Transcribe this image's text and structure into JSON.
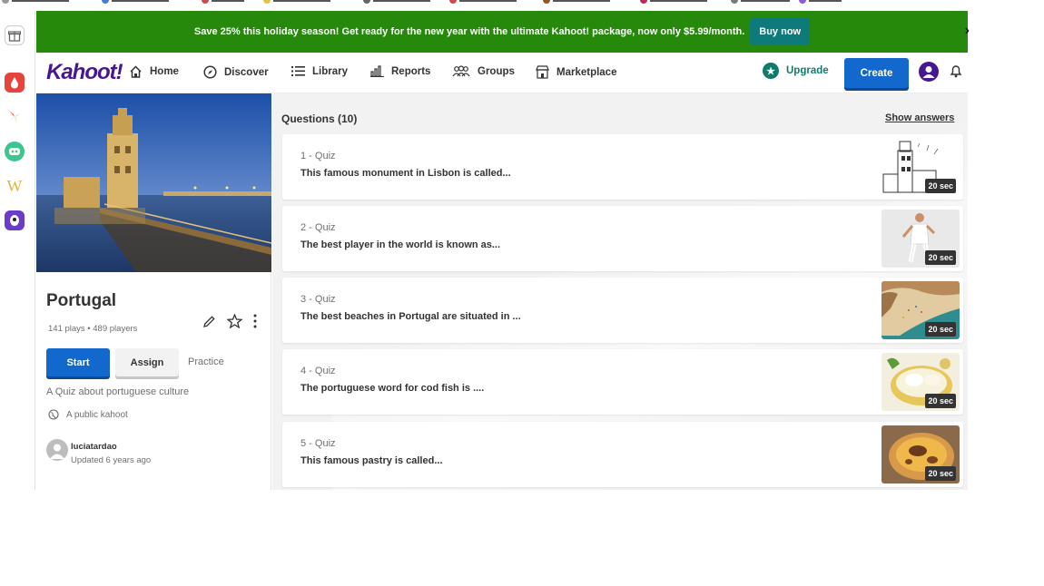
{
  "banner": {
    "message": "Save 25% this holiday season! Get ready for the new year with the ultimate Kahoot! package, now only $5.99/month.",
    "buy_label": "Buy now"
  },
  "header": {
    "logo": "Kahoot!",
    "nav": [
      {
        "label": "Home",
        "icon": "home-icon"
      },
      {
        "label": "Discover",
        "icon": "compass-icon"
      },
      {
        "label": "Library",
        "icon": "list-icon"
      },
      {
        "label": "Reports",
        "icon": "bar-chart-icon"
      },
      {
        "label": "Groups",
        "icon": "groups-icon"
      },
      {
        "label": "Marketplace",
        "icon": "store-icon"
      }
    ],
    "upgrade_label": "Upgrade",
    "create_label": "Create"
  },
  "kahoot": {
    "title": "Portugal",
    "stats": "141 plays • 489 players",
    "start_label": "Start",
    "assign_label": "Assign",
    "practice_label": "Practice",
    "description": "A Quiz about portuguese culture",
    "visibility": "A public kahoot",
    "author": "luciatardao",
    "updated": "Updated 6 years ago"
  },
  "questions": {
    "heading": "Questions (10)",
    "show_answers_label": "Show answers",
    "items": [
      {
        "type": "1 - Quiz",
        "text": "This famous monument in Lisbon is called...",
        "time": "20 sec"
      },
      {
        "type": "2 - Quiz",
        "text": "The best player in the world is known as...",
        "time": "20 sec"
      },
      {
        "type": "3 - Quiz",
        "text": "The best beaches in Portugal are situated in ...",
        "time": "20 sec"
      },
      {
        "type": "4 - Quiz",
        "text": "The portuguese word for cod fish is ....",
        "time": "20 sec"
      },
      {
        "type": "5 - Quiz",
        "text": "This famous pastry is called...",
        "time": "20 sec"
      }
    ]
  },
  "colors": {
    "banner_green": "#26890c",
    "primary_blue": "#1368ce",
    "brand_purple": "#46178f",
    "upgrade_teal": "#0f7b6c"
  }
}
